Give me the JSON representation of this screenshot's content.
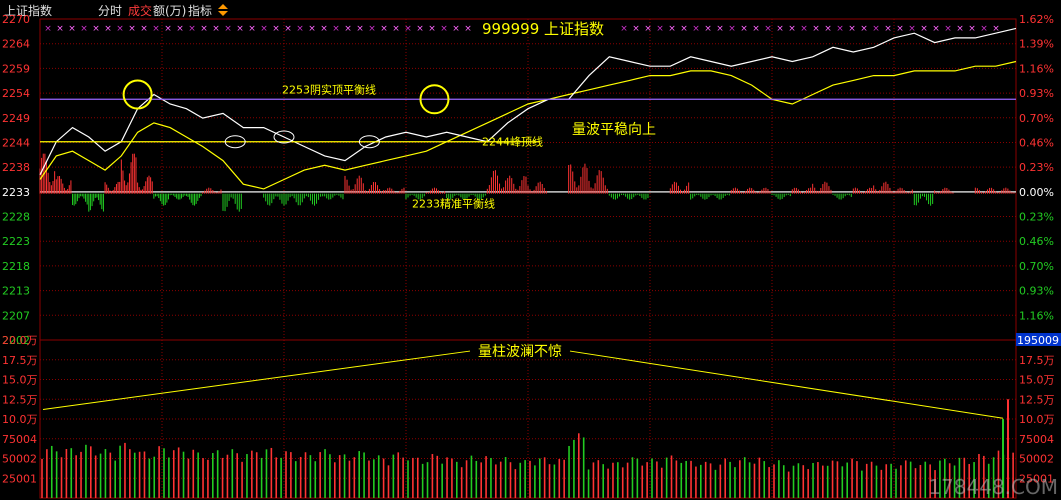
{
  "header": {
    "index_name": "上证指数",
    "tab_timeshare": "分时",
    "tab_turnover_a": "成交",
    "tab_turnover_b": "额(万)",
    "tab_indicator": "指标"
  },
  "colors": {
    "background": "#000000",
    "grid": "#8b0000",
    "price_line": "#ffffff",
    "avg_line": "#ffff00",
    "up": "#ff3333",
    "down": "#22cc22",
    "axis_up_text": "#ff3333",
    "axis_down_text": "#22cc22",
    "baseline_text": "#ffffff",
    "annotation": "#ffff00",
    "magenta": "#cc33cc"
  },
  "chart_data": [
    {
      "type": "line",
      "title": "999999 上证指数",
      "y_left_ticks": [
        "2270",
        "2264",
        "2259",
        "2254",
        "2249",
        "2244",
        "2238",
        "2233",
        "2228",
        "2223",
        "2218",
        "2213",
        "2207",
        "2202"
      ],
      "y_right_ticks": [
        "1.62%",
        "1.39%",
        "1.16%",
        "0.93%",
        "0.70%",
        "0.46%",
        "0.23%",
        "0.00%",
        "0.23%",
        "0.46%",
        "0.70%",
        "0.93%",
        "1.16%",
        "1.39%"
      ],
      "ylim": [
        2202,
        2270
      ],
      "baseline": 2233,
      "series": [
        {
          "role": "price",
          "x": [
            0,
            4,
            8,
            12,
            16,
            20,
            24,
            28,
            32,
            36,
            40,
            45,
            50,
            55,
            60,
            65,
            70,
            75,
            80,
            85,
            90,
            95,
            100,
            105,
            110,
            115,
            120,
            125,
            130,
            135,
            140,
            145,
            150,
            155,
            160,
            165,
            170,
            175,
            180,
            185,
            190,
            195,
            200,
            205,
            210,
            215,
            220,
            225,
            230,
            235,
            240
          ],
          "y": [
            2237,
            2244,
            2247,
            2245,
            2242,
            2244,
            2251,
            2254,
            2252,
            2251,
            2249,
            2250,
            2247,
            2247,
            2245,
            2243,
            2241,
            2240,
            2243,
            2245,
            2246,
            2245,
            2246,
            2245,
            2244,
            2248,
            2251,
            2253,
            2253,
            2258,
            2262,
            2261,
            2260,
            2260,
            2262,
            2261,
            2260,
            2261,
            2262,
            2261,
            2262,
            2264,
            2263,
            2264,
            2266,
            2267,
            2265,
            2266,
            2266,
            2267,
            2268
          ]
        },
        {
          "role": "average",
          "x": [
            0,
            4,
            8,
            12,
            16,
            20,
            24,
            28,
            32,
            36,
            40,
            45,
            50,
            55,
            60,
            65,
            70,
            75,
            80,
            85,
            90,
            95,
            100,
            105,
            110,
            115,
            120,
            125,
            130,
            135,
            140,
            145,
            150,
            155,
            160,
            165,
            170,
            175,
            180,
            185,
            190,
            195,
            200,
            205,
            210,
            215,
            220,
            225,
            230,
            235,
            240
          ],
          "y": [
            2236,
            2241,
            2242,
            2240,
            2238,
            2241,
            2246,
            2248,
            2247,
            2245,
            2243,
            2240,
            2235,
            2234,
            2236,
            2238,
            2239,
            2238,
            2239,
            2240,
            2241,
            2242,
            2244,
            2246,
            2248,
            2250,
            2252,
            2253,
            2254,
            2255,
            2256,
            2257,
            2258,
            2258,
            2259,
            2259,
            2258,
            2256,
            2253,
            2252,
            2254,
            2256,
            2257,
            2258,
            2258,
            2259,
            2259,
            2259,
            2260,
            2260,
            2261
          ]
        }
      ],
      "annotations": [
        "2253阴实顶平衡线",
        "2244峰顶线",
        "量波平稳向上",
        "2233精准平衡线"
      ]
    },
    {
      "type": "bar",
      "y_left_ticks": [
        "20.0万",
        "17.5万",
        "15.0万",
        "12.5万",
        "10.0万",
        "75004",
        "50002",
        "25001"
      ],
      "y_right_ticks": [
        "195009",
        "17.5万",
        "15.0万",
        "12.5万",
        "10.0万",
        "75004",
        "50002",
        "25001"
      ],
      "ylim": [
        0,
        200000
      ],
      "series": [
        {
          "name": "成交额",
          "values": [
            66000,
            64000,
            68000,
            62000,
            70000,
            60000,
            66000,
            64000,
            58000,
            62000,
            60000,
            64000,
            60000,
            58000,
            62000,
            56000,
            60000,
            54000,
            58000,
            52000,
            56000,
            50000,
            54000,
            52000,
            48000,
            52000,
            50000,
            82000,
            48000,
            46000,
            52000,
            50000,
            54000,
            48000,
            46000,
            50000,
            52000,
            48000,
            44000,
            46000,
            48000,
            50000,
            46000,
            44000,
            48000,
            46000,
            50000,
            52000,
            56000,
            60000
          ]
        }
      ],
      "annotations": [
        "量柱波澜不惊"
      ]
    }
  ],
  "watermark": "178448.COM"
}
